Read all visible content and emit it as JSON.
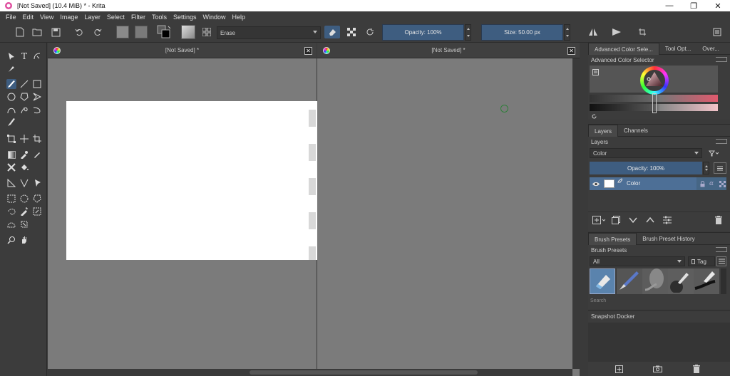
{
  "window": {
    "title": "[Not Saved]  (10.4 MiB)  * - Krita",
    "minimize_symbol": "—",
    "maximize_symbol": "❐",
    "close_symbol": "✕"
  },
  "menu": [
    "File",
    "Edit",
    "View",
    "Image",
    "Layer",
    "Select",
    "Filter",
    "Tools",
    "Settings",
    "Window",
    "Help"
  ],
  "toolbar": {
    "blend_mode": "Erase",
    "opacity_label": "Opacity: 100%",
    "opacity_value": 100,
    "size_label": "Size: 50.00 px",
    "size_value": 50.0
  },
  "views": [
    {
      "title": "[Not Saved]  *",
      "close_symbol": "✕"
    },
    {
      "title": "[Not Saved]  *",
      "close_symbol": "✕"
    }
  ],
  "dockers": {
    "top_tabs": [
      "Advanced Color Sele...",
      "Tool Opt...",
      "Over..."
    ],
    "color_selector_title": "Advanced Color Selector",
    "layer_tabs": [
      "Layers",
      "Channels"
    ],
    "layers_title": "Layers",
    "blending_mode": "Color",
    "layer_opacity": "Opacity:  100%",
    "layer_name": "Color",
    "brush_tabs": [
      "Brush Presets",
      "Brush Preset History"
    ],
    "brush_title": "Brush Presets",
    "brush_filter": "All",
    "tag_label": "Tag",
    "search_placeholder": "Search",
    "snapshot_title": "Snapshot Docker"
  },
  "colors": {
    "accent": "#3e5d80",
    "canvas_bg": "#7b7b7b",
    "panel": "#3c3c3c",
    "selected_color": "#e05a6e"
  }
}
